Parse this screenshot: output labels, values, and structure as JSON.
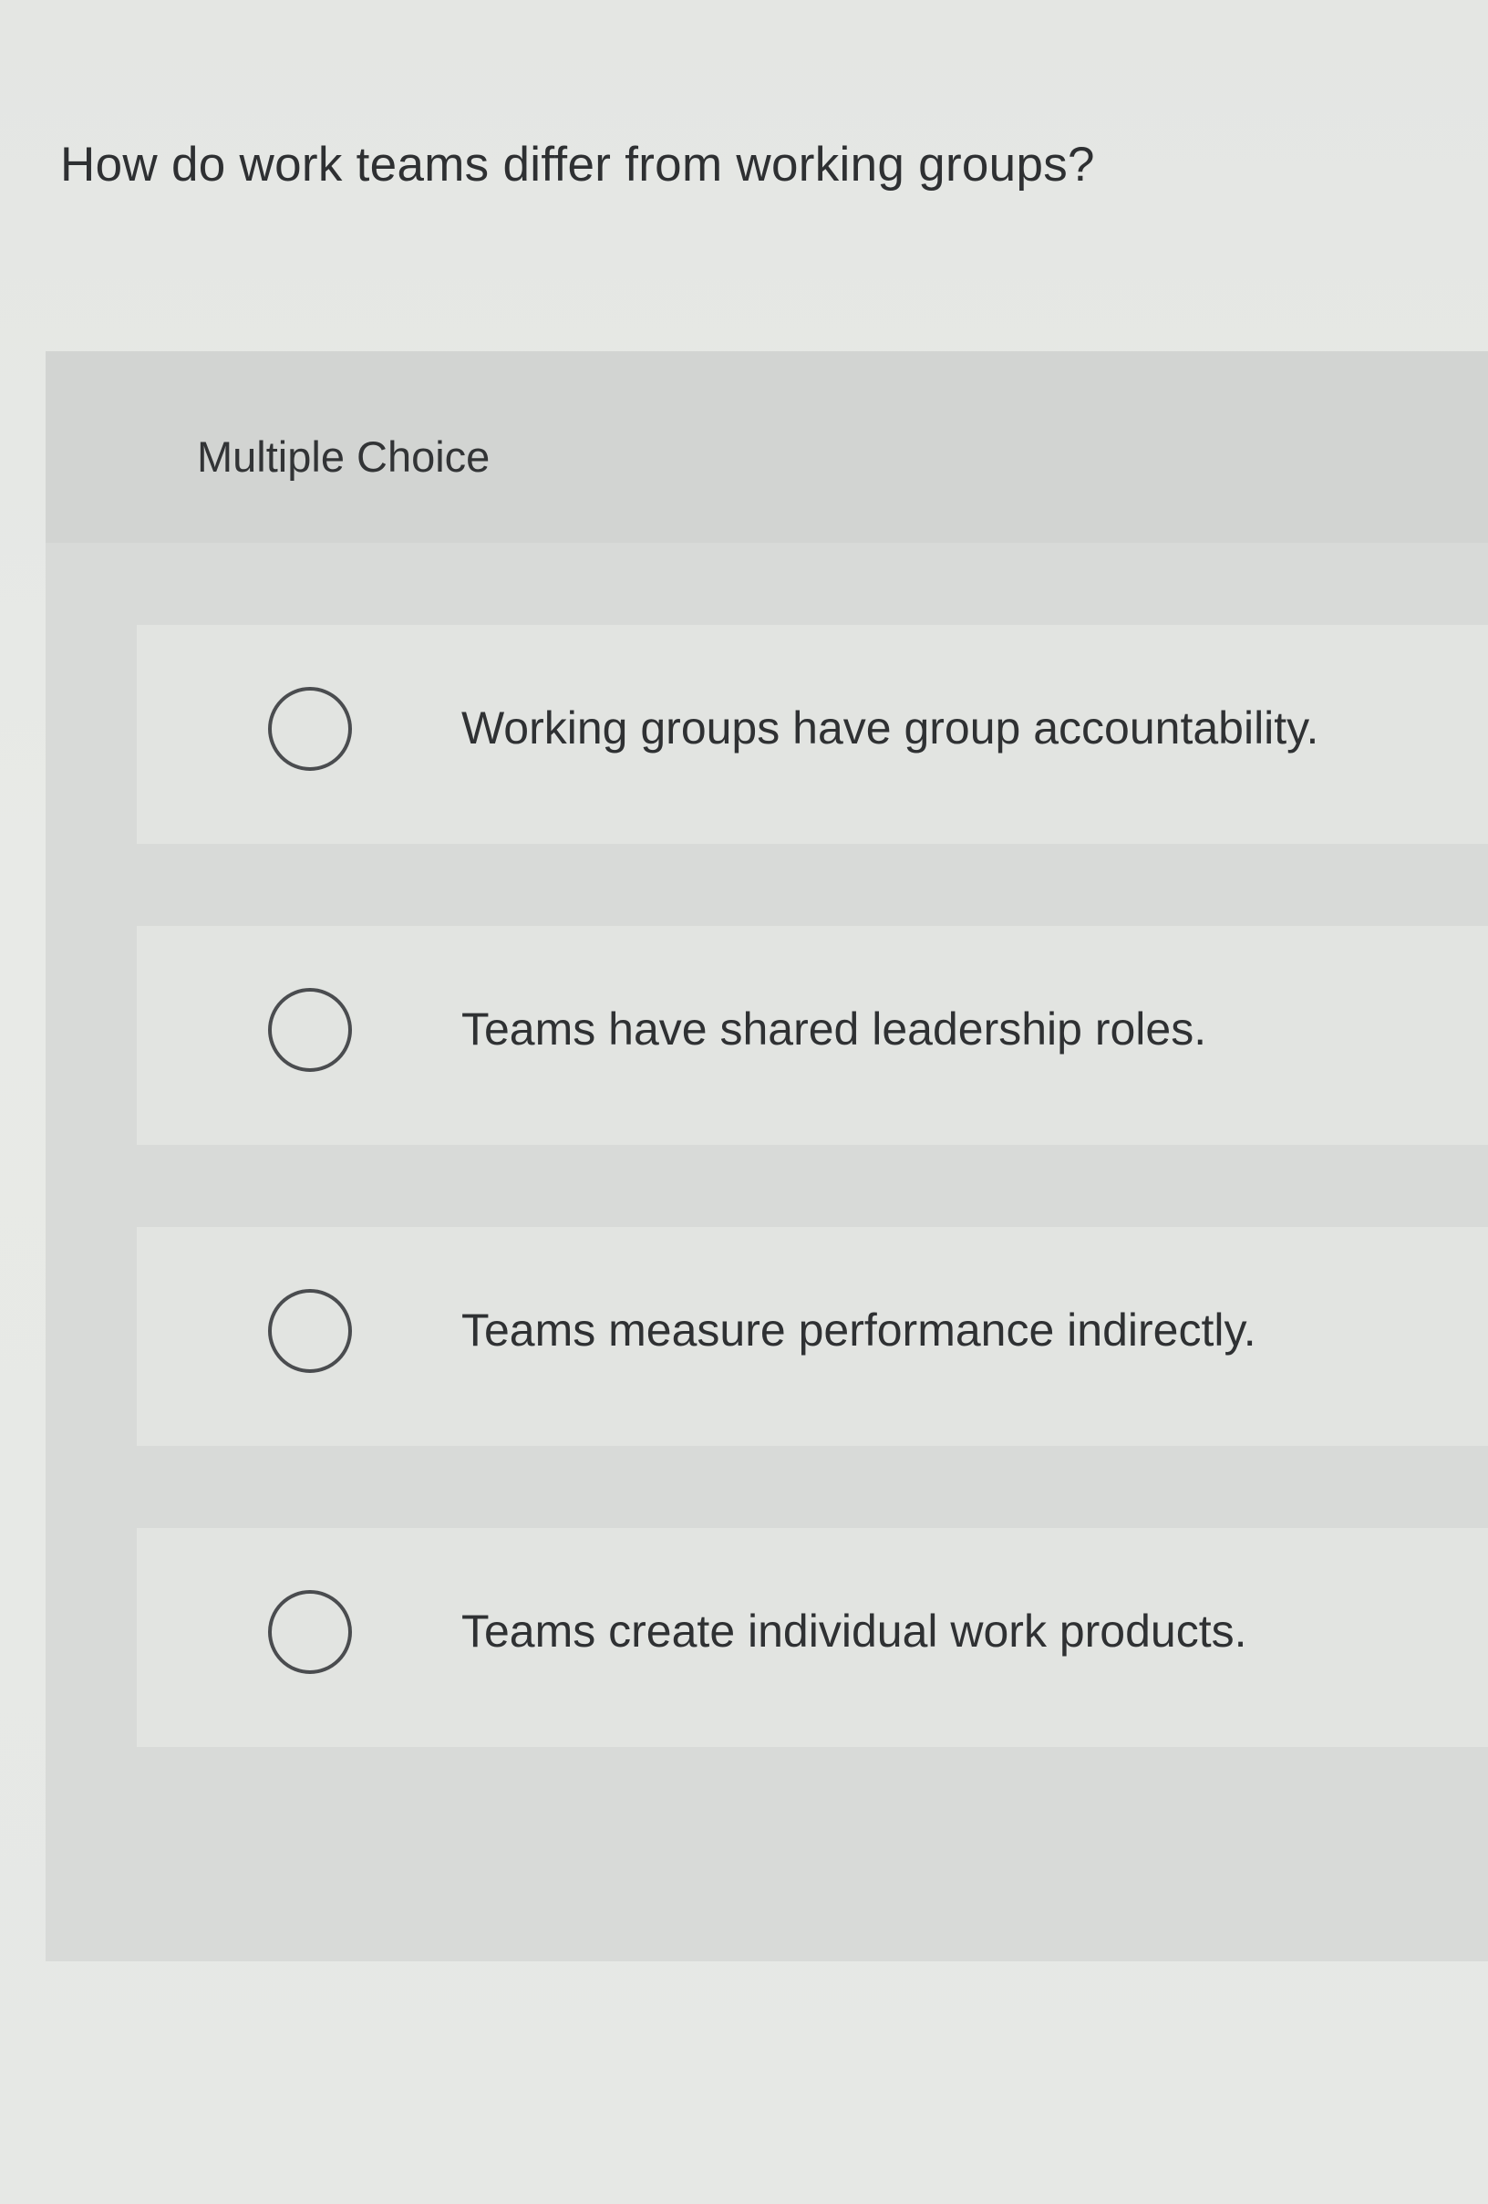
{
  "question": {
    "text": "How do work teams differ from working groups?"
  },
  "question_type": {
    "label": "Multiple Choice"
  },
  "choices": [
    {
      "text": "Working groups have group accountability."
    },
    {
      "text": "Teams have shared leadership roles."
    },
    {
      "text": "Teams measure performance indirectly."
    },
    {
      "text": "Teams create individual work products."
    }
  ],
  "colors": {
    "page_background": "#e6e8e5",
    "panel_background": "#d8dad8",
    "choice_background": "#e2e4e1",
    "text": "#2f3133",
    "radio_border": "#4a4c4f"
  }
}
